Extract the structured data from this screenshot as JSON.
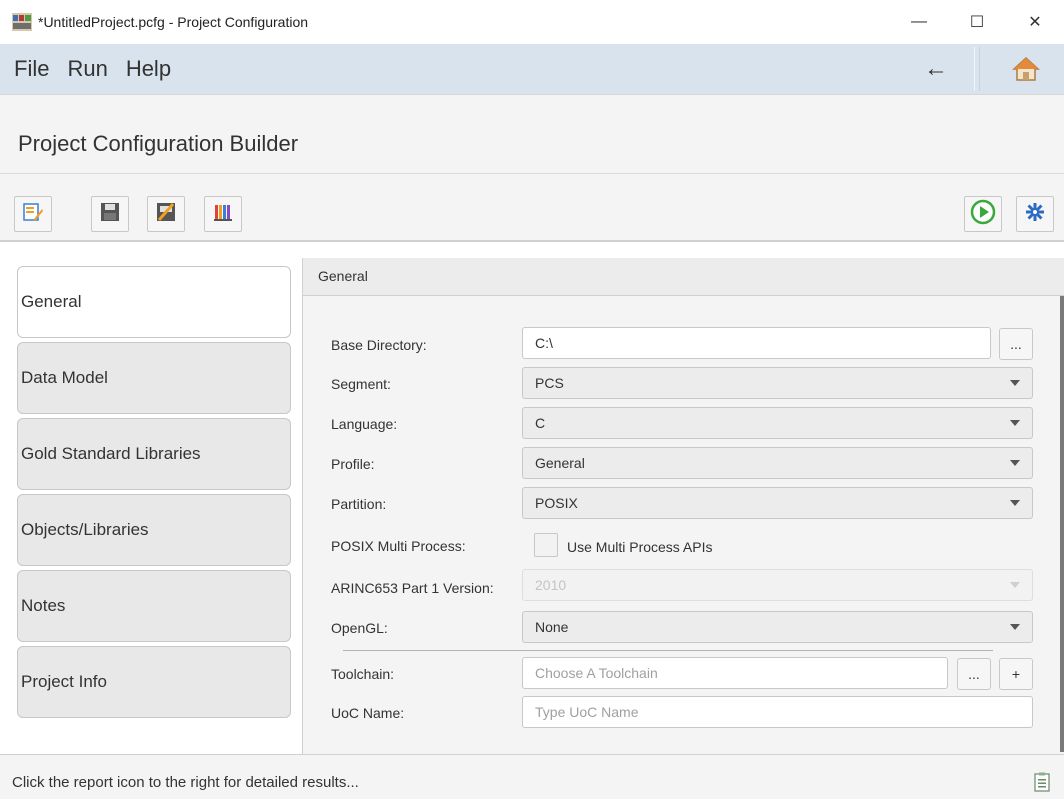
{
  "window": {
    "title": "*UntitledProject.pcfg - Project Configuration",
    "minimize": "—",
    "maximize": "☐",
    "close": "✕"
  },
  "menu": {
    "items": [
      "File",
      "Run",
      "Help"
    ],
    "back_glyph": "←"
  },
  "header": {
    "title": "Project Configuration Builder"
  },
  "toolbar": {
    "buttons": [
      "edit-config-icon",
      "save-icon",
      "validate-icon",
      "report-chart-icon",
      "run-icon",
      "settings-gear-icon"
    ],
    "accent_green": "#3aa83a",
    "accent_blue": "#2a6cc4"
  },
  "nav": {
    "items": [
      "General",
      "Data Model",
      "Gold Standard Libraries",
      "Objects/Libraries",
      "Notes",
      "Project Info"
    ],
    "active": "General"
  },
  "main": {
    "section_title": "General",
    "base_directory": {
      "label": "Base Directory:",
      "value": "C:\\",
      "browse": "..."
    },
    "segment": {
      "label": "Segment:",
      "value": "PCS"
    },
    "language": {
      "label": "Language:",
      "value": "C"
    },
    "profile": {
      "label": "Profile:",
      "value": "General"
    },
    "partition": {
      "label": "Partition:",
      "value": "POSIX"
    },
    "posix_multi": {
      "label": "POSIX Multi Process:",
      "checkbox_label": "Use Multi Process APIs",
      "checked": false
    },
    "arinc": {
      "label": "ARINC653 Part 1 Version:",
      "value": "2010",
      "disabled": true
    },
    "opengl": {
      "label": "OpenGL:",
      "value": "None"
    },
    "toolchain": {
      "label": "Toolchain:",
      "placeholder": "Choose A Toolchain",
      "browse": "...",
      "add": "+"
    },
    "uoc_name": {
      "label": "UoC Name:",
      "placeholder": "Type UoC Name"
    }
  },
  "status": {
    "text": "Click the report icon to the right for detailed results..."
  }
}
